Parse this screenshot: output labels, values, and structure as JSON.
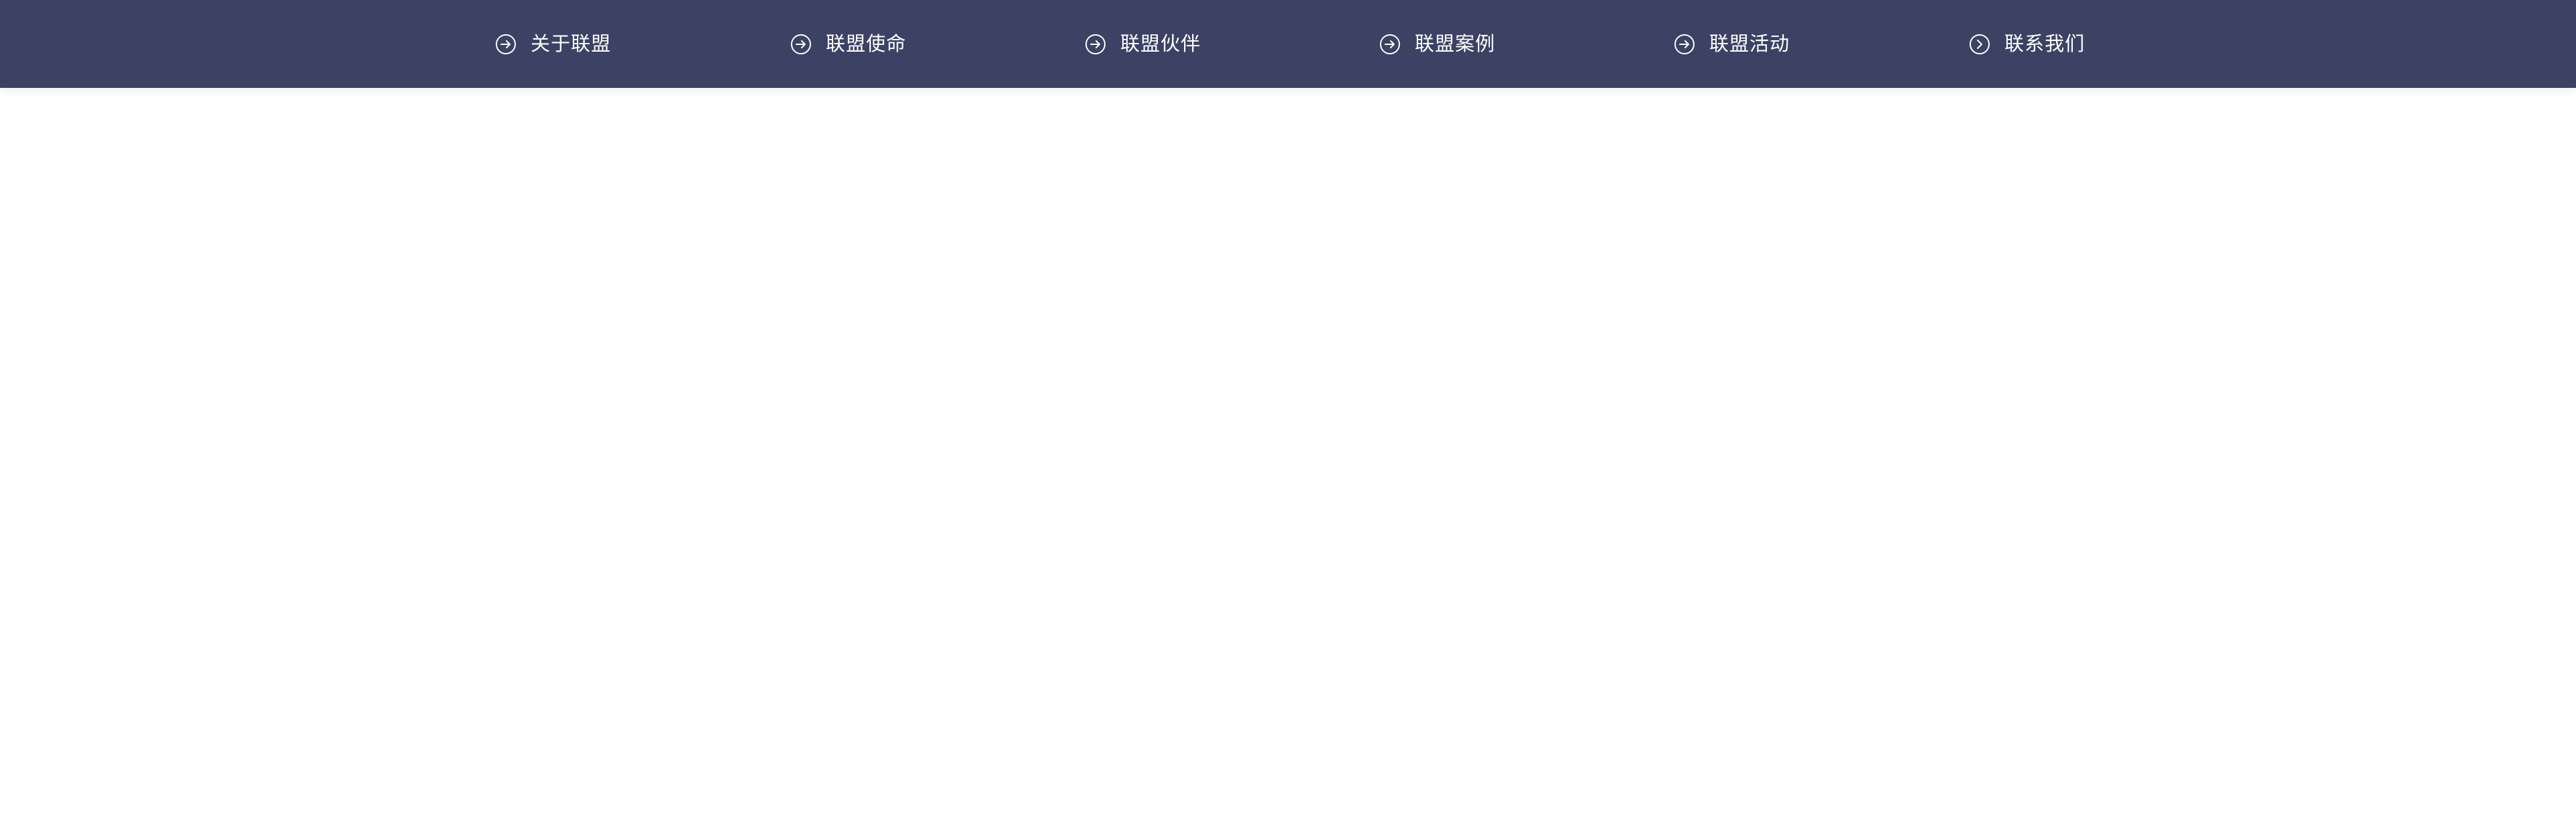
{
  "theme": {
    "nav_background": "#3b4263",
    "nav_text": "#ffffff",
    "page_background": "#ffffff"
  },
  "nav": {
    "items": [
      {
        "label": "关于联盟",
        "icon": "arrow-right-circle-icon"
      },
      {
        "label": "联盟使命",
        "icon": "arrow-right-circle-icon"
      },
      {
        "label": "联盟伙伴",
        "icon": "arrow-right-circle-icon"
      },
      {
        "label": "联盟案例",
        "icon": "arrow-right-circle-icon"
      },
      {
        "label": "联盟活动",
        "icon": "arrow-right-circle-icon"
      },
      {
        "label": "联系我们",
        "icon": "chevron-right-circle-icon"
      }
    ]
  }
}
